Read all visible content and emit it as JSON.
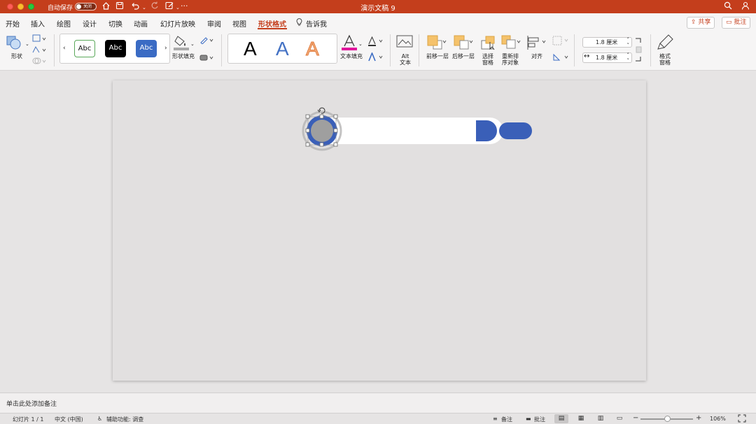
{
  "titlebar": {
    "autosave_label": "自动保存",
    "autosave_state": "关闭",
    "title": "演示文稿 9",
    "more": "···"
  },
  "tabs": [
    {
      "label": "开始"
    },
    {
      "label": "插入"
    },
    {
      "label": "绘图"
    },
    {
      "label": "设计"
    },
    {
      "label": "切换"
    },
    {
      "label": "动画"
    },
    {
      "label": "幻灯片放映"
    },
    {
      "label": "审阅"
    },
    {
      "label": "视图"
    },
    {
      "label": "形状格式",
      "active": true
    },
    {
      "label": "告诉我"
    }
  ],
  "actions": {
    "share": "共享",
    "comment": "批注"
  },
  "ribbon": {
    "shape_label": "形状",
    "style_samples": [
      "Abc",
      "Abc",
      "Abc"
    ],
    "style_colors": [
      "#ffffff",
      "#000000",
      "#3a6bc4"
    ],
    "shape_fill_label": "形状填充",
    "wordart_letter": "A",
    "wordart_colors": [
      "#000000",
      "#4472c4",
      "#f4b183"
    ],
    "text_fill_label": "文本填充",
    "alt_text_label": "Alt 文本",
    "bring_forward_label": "前移一层",
    "send_backward_label": "后移一层",
    "selection_pane_label": "选择 窗格",
    "reorder_label": "重新排 序对象",
    "align_label": "对齐",
    "height_value": "1.8 厘米",
    "width_value": "1.8 厘米",
    "format_pane_label": "格式 窗格"
  },
  "notes": {
    "placeholder": "单击此处添加备注"
  },
  "status": {
    "slide_info": "幻灯片 1 / 1",
    "language": "中文 (中国)",
    "accessibility": "辅助功能: 调查",
    "notes_btn": "备注",
    "comments_btn": "批注",
    "zoom": "106%"
  },
  "colors": {
    "accent": "#c43e1c",
    "shape_blue": "#3a5fb8",
    "shape_gray": "#9f9f9f"
  }
}
